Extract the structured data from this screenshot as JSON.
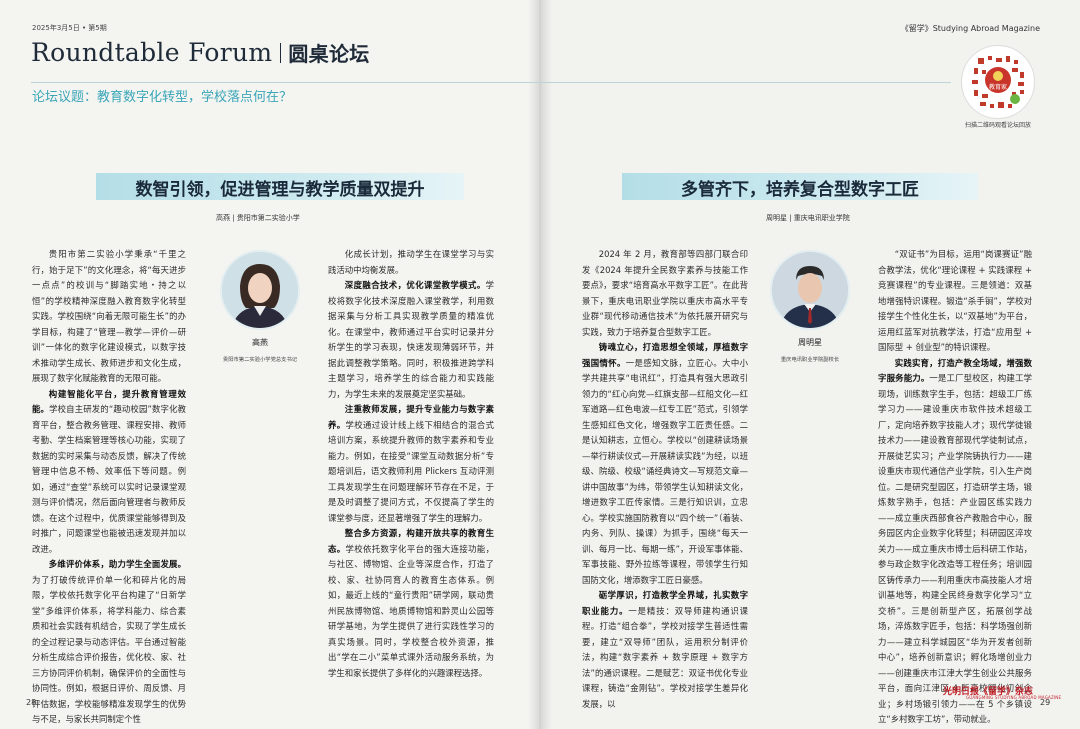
{
  "header": {
    "issue_date": "2025年3月5日 • 第5期",
    "magazine": "《留学》Studying Abroad Magazine",
    "title_en": "Roundtable Forum",
    "title_cn": "圆桌论坛",
    "topic": "论坛议题：教育数字化转型，学校落点何在？"
  },
  "qr": {
    "caption": "扫描二维码观看论坛回放",
    "badge": "教育家"
  },
  "colors": {
    "accent": "#3aa6b8",
    "banner": "#b4dee7",
    "title": "#1f2b38",
    "brand": "#c3212a"
  },
  "left_article": {
    "headline": "数智引领，促进管理与教学质量双提升",
    "byline": "高燕 | 贵阳市第二实验小学",
    "portrait": {
      "name": "高燕",
      "role": "贵阳市第二实验小学党总支书记"
    },
    "col1": [
      {
        "lead": "",
        "text": "贵阳市第二实验小学秉承“千里之行，始于足下”的文化理念，将“每天进步一点点”的校训与“脚踏实地・持之以恒”的学校精神深度融入教育数字化转型实践。学校围绕“向着无限可能生长”的办学目标，构建了“管理—教学—评价—研训”一体化的数字化建设模式，以数字技术推动学生成长、教师进步和文化生成，展现了数字化赋能教育的无限可能。"
      },
      {
        "lead": "构建智能化平台，提升教育管理效能。",
        "text": "学校自主研发的“趣动校园”数字化教育平台，整合教务管理、课程安排、教师考勤、学生档案管理等核心功能，实现了数据的实时采集与动态反馈，解决了传统管理中信息不畅、效率低下等问题。例如，通过“查堂”系统可以实时记录课堂观测与评价情况，然后面向管理者与教师反馈。在这个过程中，优质课堂能够得到及时推广，问题课堂也能被迅速发现并加以改进。"
      },
      {
        "lead": "多维评价体系，助力学生全面发展。",
        "text": "为了打破传统评价单一化和碎片化的局限，学校依托数字化平台构建了“日新学堂”多维评价体系，将学科能力、综合素质和社会实践有机结合，实现了学生成长的全过程记录与动态评估。平台通过智能分析生成综合评价报告，优化校、家、社三方协同评价机制，确保评价的全面性与协同性。例如，根据日评价、周反馈、月评估数据，学校能够精准发现学生的优势与不足，与家长共同制定个性"
      }
    ],
    "col2": [
      {
        "lead": "",
        "text": "化成长计划，推动学生在课堂学习与实践活动中均衡发展。"
      },
      {
        "lead": "深度融合技术，优化课堂教学模式。",
        "text": "学校将数字化技术深度融入课堂教学，利用数据采集与分析工具实现教学质量的精准优化。在课堂中，教师通过平台实时记录并分析学生的学习表现，快速发现薄弱环节，并据此调整教学策略。同时，积极推进跨学科主题学习，培养学生的综合能力和实践能力，为学生未来的发展奠定坚实基础。"
      },
      {
        "lead": "注重教师发展，提升专业能力与数字素养。",
        "text": "学校通过设计线上线下相结合的混合式培训方案，系统提升教师的数字素养和专业能力。例如，在接受“课堂互动数据分析”专题培训后，语文教师利用 Plickers 互动评测工具发现学生在问题理解环节存在不足，于是及时调整了提问方式，不仅提高了学生的课堂参与度，还显著增强了学生的理解力。"
      },
      {
        "lead": "整合多方资源，构建开放共享的教育生态。",
        "text": "学校依托数字化平台的强大连接功能，与社区、博物馆、企业等深度合作，打造了校、家、社协同育人的教育生态体系。例如，最近上线的“童行贵阳”研学网，联动贵州民族博物馆、地质博物馆和黔灵山公园等研学基地，为学生提供了进行实践性学习的真实场景。同时，学校整合校外资源，推出“学在二小”菜单式课外活动服务系统，为学生和家长提供了多样化的兴趣课程选择。"
      }
    ]
  },
  "right_article": {
    "headline": "多管齐下，培养复合型数字工匠",
    "byline": "周明星 | 重庆电讯职业学院",
    "portrait": {
      "name": "周明星",
      "role": "重庆电讯职业学院副校长"
    },
    "col3": [
      {
        "lead": "",
        "text": "2024 年 2 月，教育部等四部门联合印发《2024 年提升全民数字素养与技能工作要点》，要求“培育高水平数字工匠”。在此背景下，重庆电讯职业学院以重庆市高水平专业群“现代移动通信技术”为依托展开研究与实践，致力于培养复合型数字工匠。"
      },
      {
        "lead": "铸魂立心，打造思想全领域，厚植数字强国情怀。",
        "text": "一是感知文脉，立匠心。大中小学共建共享“电讯红”，打造具有强大思政引领力的“红心向党—红旗支部—红船文化—红军道路—红色电波—红专工匠”范式，引领学生感知红色文化，增强数字工匠责任感。二是认知耕志，立恒心。学校以“创建耕读场景—举行耕读仪式—开展耕读实践”为经，以班级、院级、校级“诵经典诗文—写规范文章—讲中国故事”为纬，带领学生认知耕读文化，增进数字工匠传家情。三是行知识训，立忠心。学校实施国防教育以“四个统一”（着装、内务、列队、操课）为抓手，围绕“每天一训、每月一比、每期一练”，开设军事体能、军事技能、野外拉练等课程，带领学生行知国防文化，增添数字工匠日豪感。"
      },
      {
        "lead": "砺学厚识，打造教学全界域，扎实数字职业能力。",
        "text": "一是精技：双导师建构通识课程。打造“组合拳”，学校对接学生普适性需要，建立“双导师”团队，运用积分制评价法，构建“数字素养 + 数字原理 + 数字方法”的通识课程。二是赋艺：双证书优化专业课程，铸造“金刚钻”。学校对接学生差异化发展，以"
      }
    ],
    "col4": [
      {
        "lead": "",
        "text": "“双证书”为目标，运用“岗课赛证”融合教学法，优化“理论课程 + 实践课程 + 竞赛课程”的专业课程。三是领道：双基地增强特识课程。锻造“杀手锏”，学校对接学生个性化生长，以“双基地”为平台，运用红蓝军对抗教学法，打造“应用型 + 国际型 + 创业型”的特识课程。"
      },
      {
        "lead": "实践实育，打造产教全场域，增强数字服务能力。",
        "text": "一是工厂型校区，构建工学现场，训练数字生手，包括：超级工厂练学习力——建设重庆市软件技术超级工厂，定向培养数字技能人才；现代学徒锻技术力——建设教育部现代学徒制试点，开展徒艺实习；产业学院铸执行力——建设重庆市现代通信产业学院，引入生产岗位。二是研究型园区，打造研学主场，锻炼数字熟手，包括：产业园区练实践力——成立重庆西部食谷产教融合中心，服务园区内企业数字化转型；科研园区淬攻关力——成立重庆市博士后科研工作站，参与政企数字化改造等工程任务；培训园区铸传承力——利用重庆市高技能人才培训基地等，构建全民终身数字化学习“立交桥”。三是创新型产区，拓展创学战场，淬炼数字匠手，包括：科学场强创新力——建立科学城园区“华为开发者创新中心”，培养创新意识；孵化场增创业力——创建重庆市江津大学生创业公共服务平台，面向江津区 4 所高校孵化初创企业；乡村场锻引领力——在 5 个乡镇设立“乡村数字工坊”，带动就业。"
      }
    ]
  },
  "footer": {
    "page_left": "28",
    "page_right": "29",
    "brand": "光明日报《留学》杂志",
    "brand_sub": "GUANGMING STUDYING ABROAD MAGAZINE"
  }
}
